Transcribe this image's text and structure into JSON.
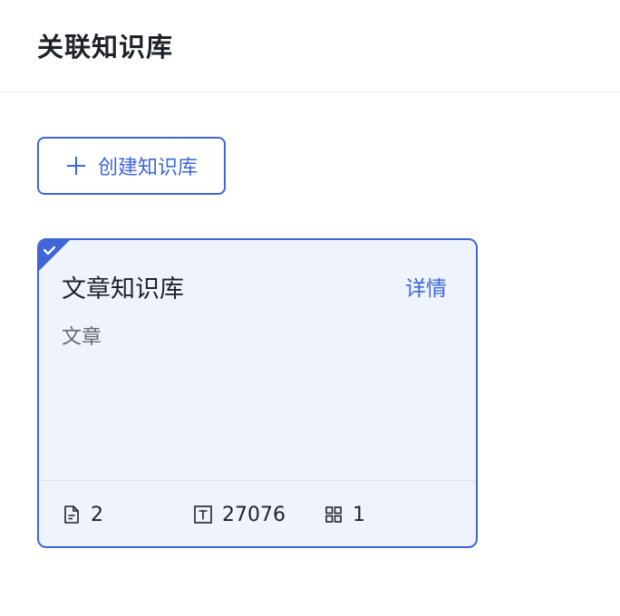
{
  "header": {
    "title": "关联知识库"
  },
  "toolbar": {
    "create_label": "创建知识库"
  },
  "card": {
    "title": "文章知识库",
    "description": "文章",
    "detail_label": "详情",
    "selected": true,
    "stats": {
      "docs": "2",
      "chars": "27076",
      "segments": "1"
    }
  },
  "colors": {
    "accent": "#3e66d6",
    "card_bg": "#eef3fc"
  }
}
